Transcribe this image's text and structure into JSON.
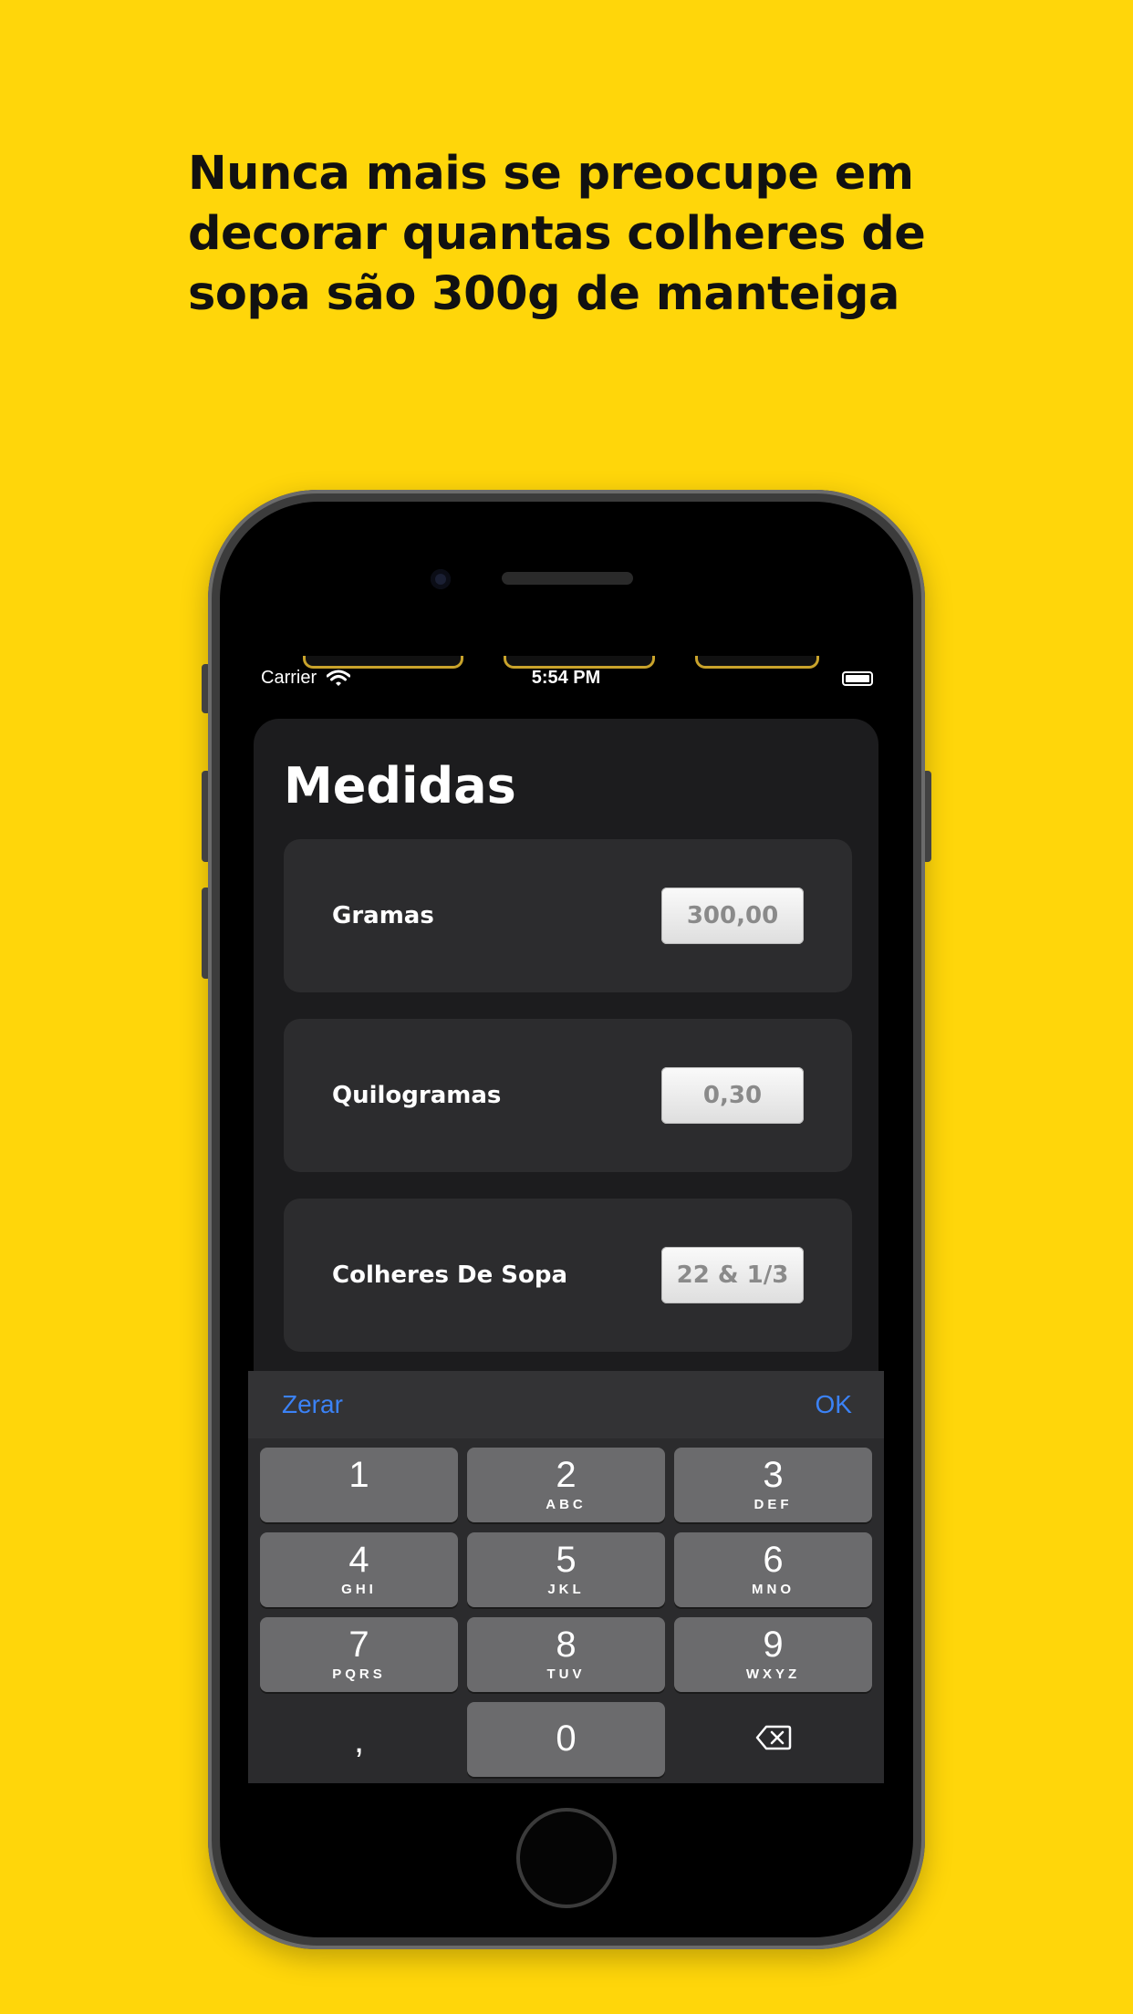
{
  "headline": {
    "lines": [
      "Nunca mais se preocupe em",
      "decorar quantas colheres de",
      "sopa são 300g de manteiga"
    ]
  },
  "status_bar": {
    "carrier": "Carrier",
    "time": "5:54 PM"
  },
  "app": {
    "title": "Medidas",
    "rows": [
      {
        "label": "Gramas",
        "value": "300,00"
      },
      {
        "label": "Quilogramas",
        "value": "0,30"
      },
      {
        "label": "Colheres De Sopa",
        "value": "22 & 1/3"
      }
    ]
  },
  "keyboard": {
    "accessory_left": "Zerar",
    "accessory_right": "OK",
    "keys": [
      {
        "digit": "1",
        "letters": ""
      },
      {
        "digit": "2",
        "letters": "ABC"
      },
      {
        "digit": "3",
        "letters": "DEF"
      },
      {
        "digit": "4",
        "letters": "GHI"
      },
      {
        "digit": "5",
        "letters": "JKL"
      },
      {
        "digit": "6",
        "letters": "MNO"
      },
      {
        "digit": "7",
        "letters": "PQRS"
      },
      {
        "digit": "8",
        "letters": "TUV"
      },
      {
        "digit": "9",
        "letters": "WXYZ"
      }
    ],
    "comma": ",",
    "zero": "0",
    "delete_icon": "backspace-icon"
  },
  "colors": {
    "background": "#FFD60A",
    "accent": "#3b82f6",
    "sheet": "#1c1c1e",
    "row": "#2c2c2e"
  }
}
